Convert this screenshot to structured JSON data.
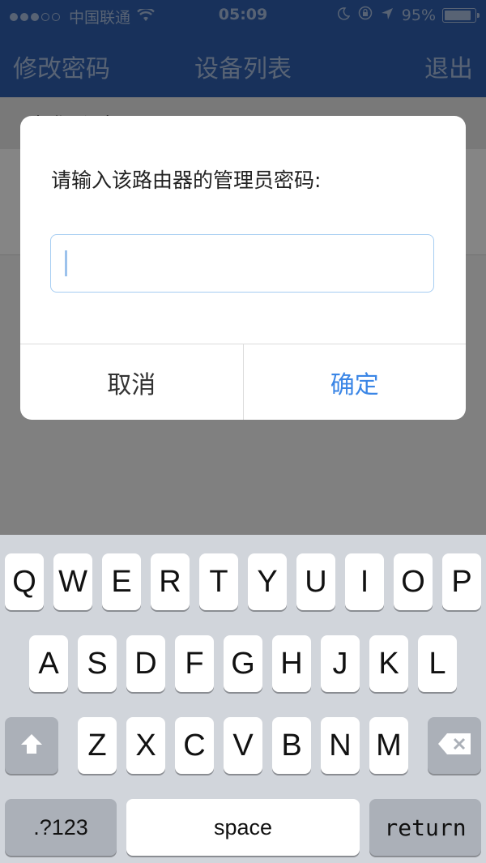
{
  "status_bar": {
    "carrier": "中国联通",
    "time": "05:09",
    "battery_percent": "95%",
    "battery_level": 0.95,
    "signal_dots_filled": 3,
    "signal_dots_total": 5
  },
  "navbar": {
    "left_label": "修改密码",
    "title": "设备列表",
    "right_label": "退出"
  },
  "content": {
    "section_header": "本登录设备"
  },
  "alert": {
    "message": "请输入该路由器的管理员密码:",
    "input_value": "",
    "cancel_label": "取消",
    "ok_label": "确定"
  },
  "keyboard": {
    "row1": [
      "Q",
      "W",
      "E",
      "R",
      "T",
      "Y",
      "U",
      "I",
      "O",
      "P"
    ],
    "row2": [
      "A",
      "S",
      "D",
      "F",
      "G",
      "H",
      "J",
      "K",
      "L"
    ],
    "row3": [
      "Z",
      "X",
      "C",
      "V",
      "B",
      "N",
      "M"
    ],
    "numbers_label": ".?123",
    "space_label": "space",
    "return_label": "return"
  },
  "colors": {
    "nav_background": "#2f5fae",
    "accent_blue": "#3b86e6",
    "keyboard_background": "#d1d5db"
  }
}
